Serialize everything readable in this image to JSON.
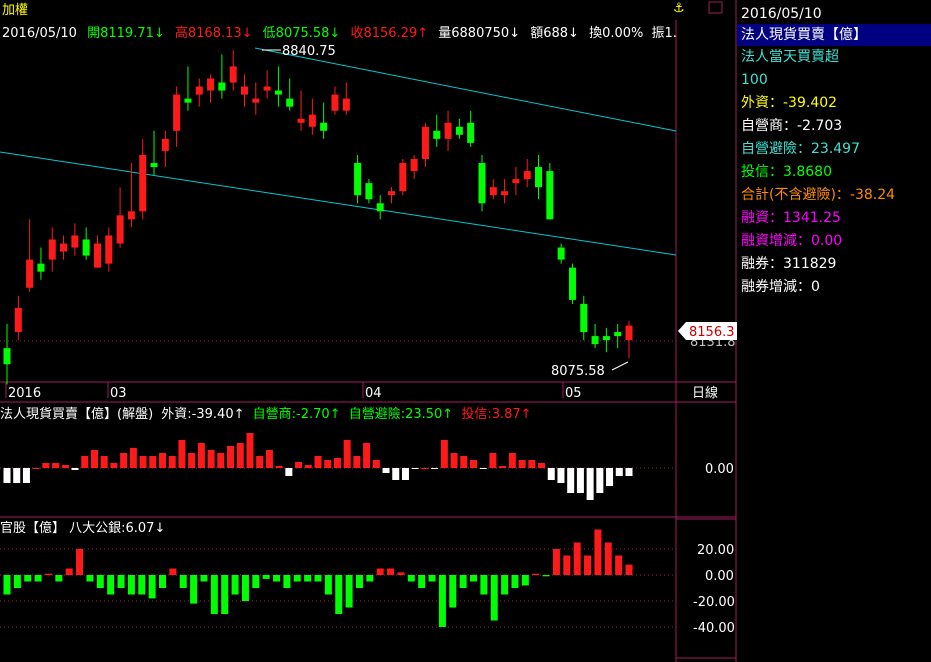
{
  "header": {
    "title": "加權",
    "date": "2016/05/10",
    "open": "開8119.71↓",
    "high": "高8168.13↓",
    "low": "低8075.58↓",
    "close": "收8156.29↑",
    "volume": "量6880750↓",
    "amount": "額688↓",
    "turnover": "換0.00%",
    "amplitude": "振1."
  },
  "price_panel": {
    "peak_label": "8840.75",
    "trough_label": "8075.58",
    "current_price_tag": "8156.3",
    "right_axis_value": "8131.8",
    "x_labels": [
      "2016",
      "03",
      "04",
      "05"
    ],
    "period_label": "日線"
  },
  "institutional_panel": {
    "title": "法人現貨買賣【億】(解盤)",
    "foreign": "外資:-39.40↑",
    "dealer": "自營商:-2.70↑",
    "dealer_hedge": "自營避險:23.50↑",
    "trust": "投信:3.87↑",
    "axis_label": "0.00"
  },
  "gov_panel": {
    "title": "官股【億】 八大公銀:6.07↓",
    "axis_labels": [
      "20.00",
      "0.00",
      "-20.00",
      "-40.00"
    ]
  },
  "sidebar": {
    "date": "2016/05/10",
    "selected_item": "法人現貨買賣【億】",
    "subtitle": "法人當天買賣超",
    "value_100": "100",
    "foreign": "外資：-39.402",
    "dealer": "自營商：-2.703",
    "dealer_hedge": "自營避險：23.497",
    "trust": "投信：3.8680",
    "total_ex_hedge": "合計(不含避險)：-38.24",
    "margin": "融資：1341.25",
    "margin_change": "融資增減：0.00",
    "short": "融券：311829",
    "short_change": "融券增減：0"
  },
  "colors": {
    "up": "#ff1a1a",
    "down": "#00ff00",
    "trend_line": "#00c8d0",
    "panel_border": "#a0205a",
    "selected_bg": "#000080"
  },
  "chart_data": [
    {
      "type": "candlestick",
      "title": "加權",
      "x": [
        "2016",
        "03",
        "04",
        "05"
      ],
      "annotations": {
        "high": 8840.75,
        "low": 8075.58,
        "last": 8156.3
      },
      "ohlc": [
        [
          8100,
          8160,
          8010,
          8060
        ],
        [
          8140,
          8230,
          8120,
          8200
        ],
        [
          8250,
          8420,
          8240,
          8320
        ],
        [
          8310,
          8350,
          8270,
          8290
        ],
        [
          8320,
          8400,
          8290,
          8370
        ],
        [
          8340,
          8380,
          8320,
          8360
        ],
        [
          8350,
          8410,
          8330,
          8380
        ],
        [
          8370,
          8400,
          8320,
          8330
        ],
        [
          8300,
          8380,
          8300,
          8360
        ],
        [
          8310,
          8400,
          8290,
          8380
        ],
        [
          8360,
          8500,
          8350,
          8430
        ],
        [
          8420,
          8560,
          8400,
          8440
        ],
        [
          8440,
          8620,
          8420,
          8580
        ],
        [
          8560,
          8640,
          8530,
          8550
        ],
        [
          8590,
          8640,
          8550,
          8620
        ],
        [
          8640,
          8750,
          8600,
          8730
        ],
        [
          8720,
          8800,
          8690,
          8710
        ],
        [
          8730,
          8770,
          8700,
          8750
        ],
        [
          8740,
          8780,
          8710,
          8770
        ],
        [
          8760,
          8830,
          8720,
          8740
        ],
        [
          8760,
          8840,
          8740,
          8800
        ],
        [
          8730,
          8780,
          8700,
          8750
        ],
        [
          8710,
          8760,
          8680,
          8720
        ],
        [
          8740,
          8790,
          8720,
          8750
        ],
        [
          8740,
          8800,
          8700,
          8730
        ],
        [
          8720,
          8770,
          8690,
          8700
        ],
        [
          8660,
          8740,
          8640,
          8670
        ],
        [
          8650,
          8720,
          8630,
          8680
        ],
        [
          8660,
          8710,
          8620,
          8640
        ],
        [
          8690,
          8750,
          8680,
          8730
        ],
        [
          8690,
          8760,
          8680,
          8720
        ],
        [
          8560,
          8580,
          8460,
          8480
        ],
        [
          8510,
          8520,
          8460,
          8470
        ],
        [
          8460,
          8480,
          8420,
          8440
        ],
        [
          8480,
          8500,
          8460,
          8490
        ],
        [
          8490,
          8570,
          8480,
          8560
        ],
        [
          8540,
          8580,
          8520,
          8570
        ],
        [
          8570,
          8660,
          8550,
          8650
        ],
        [
          8640,
          8680,
          8600,
          8620
        ],
        [
          8620,
          8690,
          8590,
          8660
        ],
        [
          8650,
          8670,
          8620,
          8630
        ],
        [
          8660,
          8690,
          8600,
          8610
        ],
        [
          8560,
          8580,
          8440,
          8460
        ],
        [
          8480,
          8520,
          8470,
          8500
        ],
        [
          8480,
          8520,
          8460,
          8490
        ],
        [
          8510,
          8550,
          8480,
          8520
        ],
        [
          8520,
          8570,
          8500,
          8540
        ],
        [
          8550,
          8580,
          8470,
          8500
        ],
        [
          8540,
          8560,
          8420,
          8420
        ],
        [
          8350,
          8360,
          8310,
          8320
        ],
        [
          8300,
          8310,
          8210,
          8220
        ],
        [
          8210,
          8230,
          8120,
          8140
        ],
        [
          8130,
          8160,
          8100,
          8110
        ],
        [
          8130,
          8150,
          8090,
          8120
        ],
        [
          8140,
          8160,
          8100,
          8130
        ],
        [
          8120,
          8168,
          8075,
          8156
        ]
      ]
    },
    {
      "type": "bar",
      "title": "法人現貨買賣【億】(解盤)",
      "ylim": [
        -40,
        40
      ],
      "values": [
        -15,
        -15,
        -15,
        0,
        5,
        5,
        3,
        -2,
        12,
        18,
        12,
        5,
        15,
        20,
        12,
        12,
        15,
        12,
        28,
        15,
        25,
        18,
        15,
        22,
        25,
        35,
        12,
        18,
        2,
        -8,
        6,
        3,
        12,
        8,
        10,
        28,
        12,
        25,
        8,
        -5,
        -12,
        -12,
        -1,
        0,
        -1,
        28,
        15,
        12,
        8,
        -1,
        15,
        2,
        15,
        8,
        8,
        5,
        -12,
        -15,
        -25,
        -25,
        -32,
        -25,
        -18,
        -8,
        -8
      ],
      "series": [
        {
          "name": "外資",
          "value": -39.4
        },
        {
          "name": "自營商",
          "value": -2.7
        },
        {
          "name": "自營避險",
          "value": 23.5
        },
        {
          "name": "投信",
          "value": 3.87
        }
      ]
    },
    {
      "type": "bar",
      "title": "官股【億】 八大公銀",
      "ylim": [
        -50,
        30
      ],
      "values": [
        -15,
        -10,
        -5,
        -5,
        1,
        -5,
        5,
        20,
        -5,
        -10,
        -15,
        -10,
        -15,
        -15,
        -18,
        -10,
        5,
        -10,
        -22,
        -5,
        -30,
        -30,
        -15,
        -20,
        -10,
        -3,
        -5,
        -10,
        -5,
        -5,
        -5,
        -15,
        -30,
        -25,
        -10,
        -5,
        5,
        5,
        2,
        -5,
        -10,
        -5,
        -40,
        -25,
        -10,
        -5,
        -15,
        -35,
        -15,
        -10,
        -8,
        1,
        -1,
        20,
        15,
        25,
        15,
        35,
        25,
        15,
        8
      ],
      "series": [
        {
          "name": "八大公銀",
          "value": 6.07
        }
      ]
    }
  ]
}
